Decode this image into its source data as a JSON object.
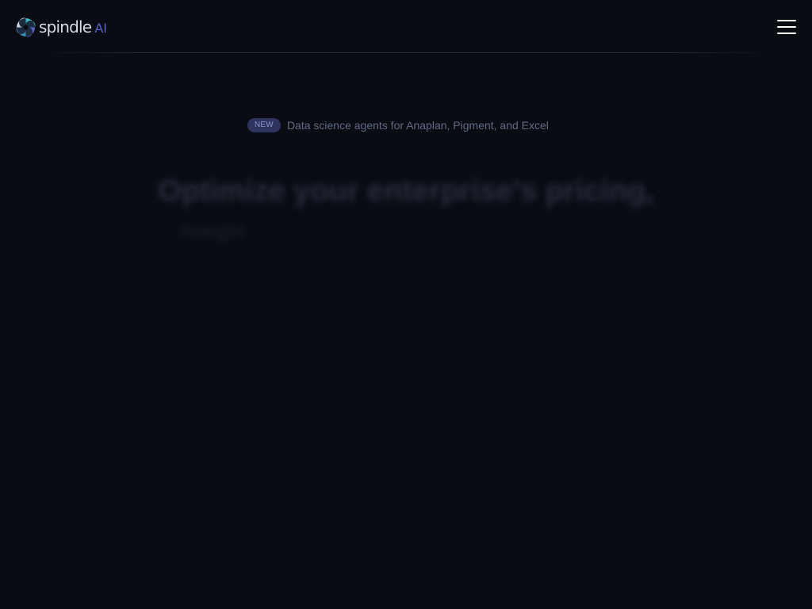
{
  "header": {
    "logo_word": "spindle",
    "logo_ai": "AI",
    "menu_icon": "hamburger-menu-icon"
  },
  "announcement": {
    "badge": "NEW",
    "text": "Data science agents for Anaplan, Pigment, and Excel"
  },
  "hero": {
    "title": "Optimize your enterprise's pricing,",
    "subtitle": "margin"
  },
  "colors": {
    "background": "#0a0c14",
    "accent": "#5865c6",
    "badge_bg": "#2e3360",
    "logo_teal": "#3fb6c2"
  }
}
